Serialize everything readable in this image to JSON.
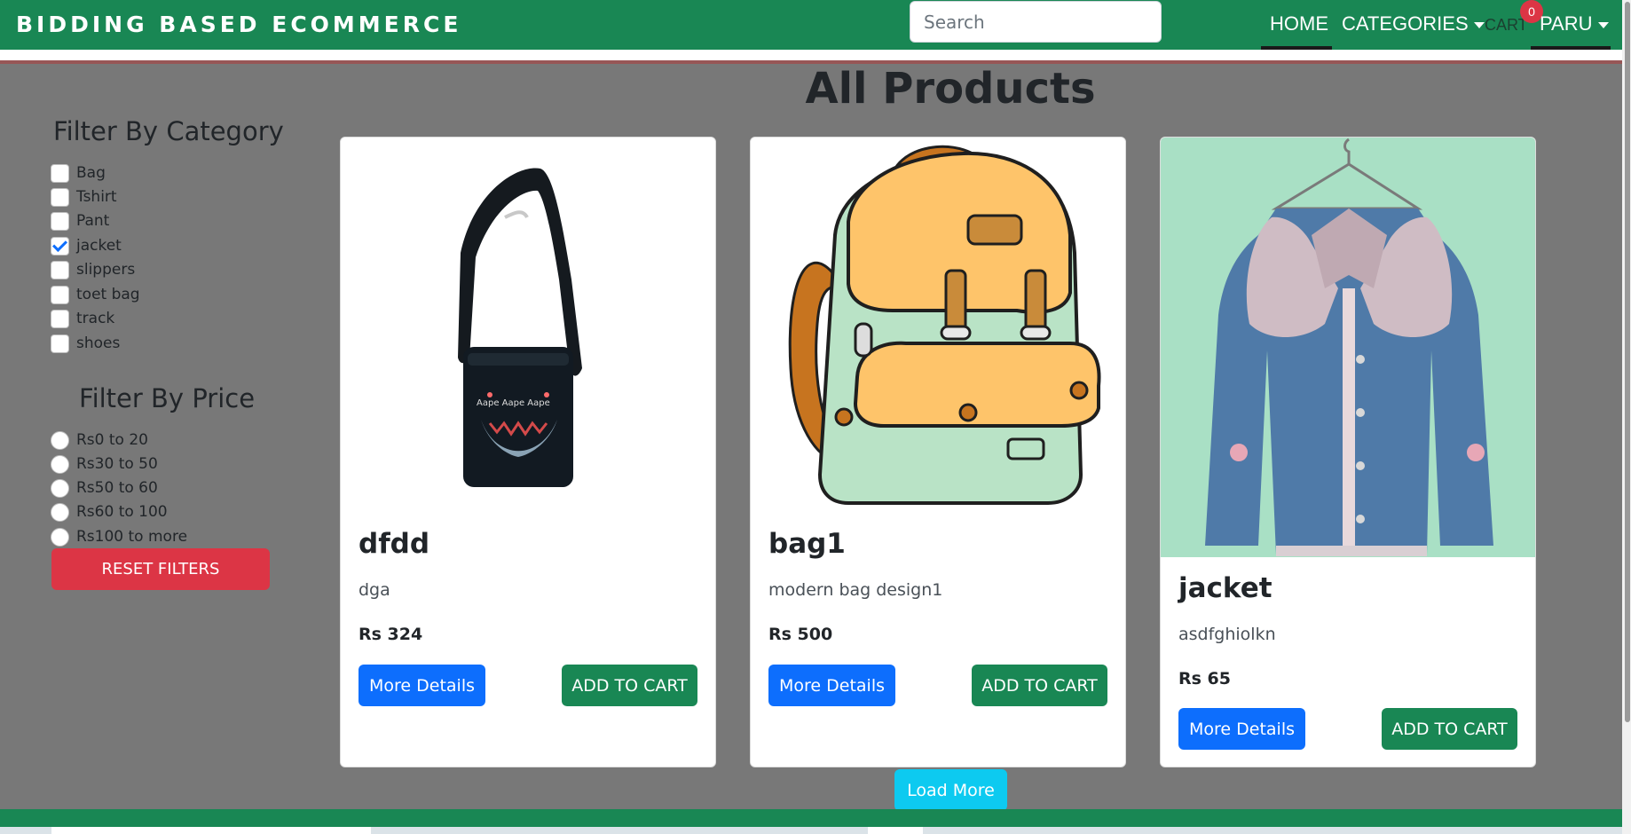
{
  "header": {
    "brand": "BIDDING BASED ECOMMERCE",
    "search_placeholder": "Search",
    "nav": {
      "home": "HOME",
      "categories": "CATEGORIES",
      "cart": "CART",
      "cart_count": "0",
      "user": "PARU"
    }
  },
  "page_title": "All Products",
  "sidebar": {
    "category_heading": "Filter By Category",
    "categories": [
      {
        "label": "Bag",
        "checked": false
      },
      {
        "label": "Tshirt",
        "checked": false
      },
      {
        "label": "Pant",
        "checked": false
      },
      {
        "label": "jacket",
        "checked": true
      },
      {
        "label": "slippers",
        "checked": false
      },
      {
        "label": "toet bag",
        "checked": false
      },
      {
        "label": "track",
        "checked": false
      },
      {
        "label": "shoes",
        "checked": false
      }
    ],
    "price_heading": "Filter By Price",
    "prices": [
      {
        "label": "Rs0 to 20"
      },
      {
        "label": "Rs30 to 50"
      },
      {
        "label": "Rs50 to 60"
      },
      {
        "label": "Rs60 to 100"
      },
      {
        "label": "Rs100 to more"
      }
    ],
    "reset_label": "RESET FILTERS"
  },
  "products": [
    {
      "name": "dfdd",
      "description": "dga",
      "price": "Rs 324",
      "details_label": "More Details",
      "cart_label": "ADD TO CART",
      "image": "shoulder-bag-image"
    },
    {
      "name": "bag1",
      "description": "modern bag design1",
      "price": "Rs 500",
      "details_label": "More Details",
      "cart_label": "ADD TO CART",
      "image": "backpack-image"
    },
    {
      "name": "jacket",
      "description": "asdfghiolkn",
      "price": "Rs 65",
      "details_label": "More Details",
      "cart_label": "ADD TO CART",
      "image": "denim-jacket-image"
    }
  ],
  "load_more_label": "Load More",
  "colors": {
    "brand_green": "#198754",
    "primary_blue": "#0d6efd",
    "danger_red": "#dc3545",
    "info_cyan": "#0dcaf0",
    "page_overlay": "#787878"
  }
}
